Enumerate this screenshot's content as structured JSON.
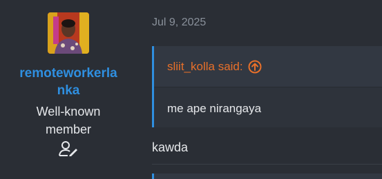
{
  "user": {
    "username": "remoteworkerlanka",
    "title": "Well-known member",
    "avatar_icon": "avatar-photo",
    "profile_icon": "user-edit-icon"
  },
  "post": {
    "date": "Jul 9, 2025",
    "quote": {
      "author_label": "sliit_kolla said:",
      "jump_icon": "arrow-up-circle-icon",
      "text": "me ape nirangaya"
    },
    "reply_text": "kawda"
  },
  "colors": {
    "background": "#2a2e35",
    "accent_blue": "#2f8fe0",
    "quote_orange": "#e8702a",
    "muted": "#8a919b"
  }
}
